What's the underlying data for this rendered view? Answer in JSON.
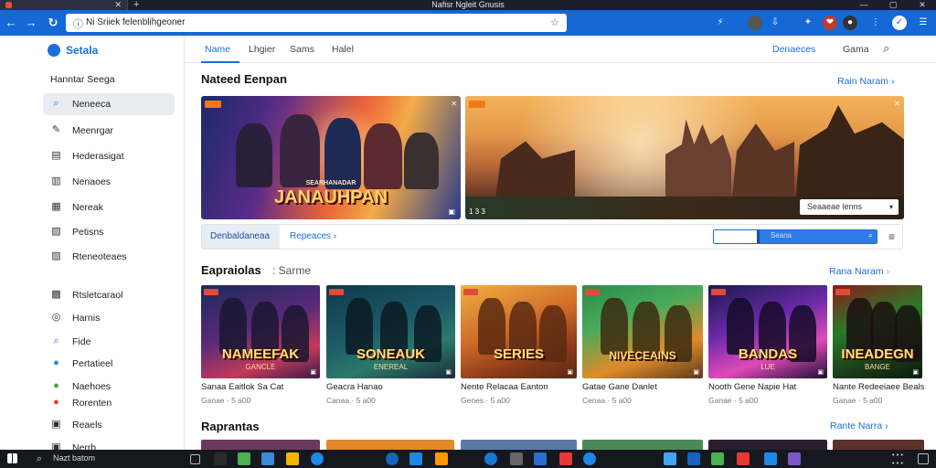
{
  "window": {
    "title": "Nafisr Ngleit Gnusis",
    "tab_close": "✕",
    "newtab": "+",
    "controls": [
      "—",
      "▢",
      "✕"
    ]
  },
  "addressbar": {
    "url": "Ni Sriiek felenblihgeoner",
    "back": "←",
    "forward": "→",
    "extensions": [
      "⚡",
      "✦",
      "❤",
      "●"
    ]
  },
  "sidebar": {
    "brand": "Setala",
    "heading": "Hanntar  Seega",
    "items": [
      {
        "label": "Neneeca",
        "icon": "⌕",
        "active": true
      },
      {
        "label": "Meenrgar",
        "icon": "✎"
      },
      {
        "label": "Hederasigat",
        "icon": "▤"
      },
      {
        "label": "Nenaoes",
        "icon": "▥"
      },
      {
        "label": "Nereak",
        "icon": "▦"
      },
      {
        "label": "Petisns",
        "icon": "▧"
      },
      {
        "label": "Rteneoteaes",
        "icon": "▨"
      },
      {
        "label": "Rtsletcaraol",
        "icon": "▩"
      },
      {
        "label": "Harnis",
        "icon": "◎"
      },
      {
        "label": "Fide",
        "icon": "⌕"
      },
      {
        "label": "Pertatieel",
        "icon": "●"
      },
      {
        "label": "Naehoes",
        "icon": "●"
      },
      {
        "label": "Rorenten",
        "icon": "●"
      },
      {
        "label": "Reaels",
        "icon": "▣"
      },
      {
        "label": "Nerrh",
        "icon": "▣"
      }
    ]
  },
  "topnav": {
    "tabs": [
      "Name",
      "Lhgier",
      "Sams",
      "Halel"
    ],
    "active": 0,
    "right_link": "Denaeces",
    "right_text": "Gama"
  },
  "featured": {
    "title": "Nateed Eenpan",
    "link": "Rain  Naram",
    "banners": [
      {
        "title": "JANAUHPAN",
        "subtitle": "SEARHANADAR",
        "count": "▣",
        "corner": "✕"
      },
      {
        "title": "",
        "count": "1 3 3",
        "button": "Seaaeae lenns",
        "corner": "✕"
      }
    ]
  },
  "filters": {
    "chip": "Denbaldaneaa",
    "link": "Repeaces",
    "search_text": "Seana"
  },
  "games_section": {
    "title": "Eapraiolas",
    "sub": ": Sarme",
    "link": "Rana  Naram",
    "cards": [
      {
        "name": "Sanaa Eaitlok Sa Cat",
        "meta": "Ganae  · 5 a00",
        "art_title": "NAMEEFAK",
        "art_sub": "GANCLE",
        "count": "▣"
      },
      {
        "name": "Geacra Hanao",
        "meta": "Canaa  · 5 a00",
        "art_title": "SONEAUK",
        "art_sub": "ENEREAL",
        "count": "▣"
      },
      {
        "name": "Nente Relacaa Eanton",
        "meta": "Genes  · 5 a00",
        "art_title": "SERIES",
        "art_sub": "",
        "count": "▣"
      },
      {
        "name": "Gatae Gane Danlet",
        "meta": "Cenaa  · 5 a00",
        "art_title": "NIVECEAINS",
        "art_sub": "",
        "count": "▣"
      },
      {
        "name": "Nooth Gene Napie Hat",
        "meta": "Ganae  · 5 a00",
        "art_title": "BANDAS",
        "art_sub": "LUE",
        "count": "▣"
      },
      {
        "name": "Nante Redeeiaee Beals",
        "meta": "Ganae  · 5 a00",
        "art_title": "INEADEGN",
        "art_sub": "BANGE",
        "count": "▣"
      }
    ]
  },
  "next_section": {
    "title": "Raprantas",
    "link": "Rante  Narra"
  },
  "taskbar": {
    "search": "Nazt batom",
    "clock_line1": "• • •",
    "clock_line2": "• • •"
  },
  "colors": {
    "accent": "#1a6fe0",
    "addressbar": "#1568d6",
    "titlebar": "#1a1f2b",
    "taskbar": "#15181f"
  }
}
